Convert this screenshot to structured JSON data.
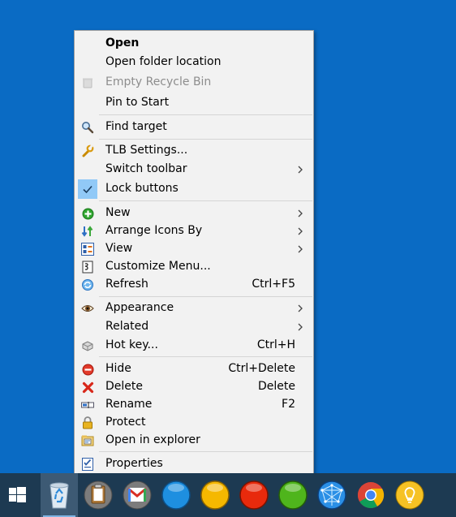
{
  "menu": {
    "items": [
      {
        "label": "Open",
        "bold": true
      },
      {
        "label": "Open folder location"
      },
      {
        "label": "Empty Recycle Bin",
        "icon": "recycle-bin-icon",
        "disabled": true
      },
      {
        "label": "Pin to Start"
      },
      {
        "label": "Find target",
        "icon": "magnifier-icon"
      },
      {
        "label": "TLB Settings...",
        "icon": "wrench-icon"
      },
      {
        "label": "Switch toolbar",
        "submenu": true
      },
      {
        "label": "Lock buttons",
        "checked": true,
        "icon": "checkmark-icon"
      },
      {
        "label": "New",
        "icon": "green-plus-icon",
        "submenu": true
      },
      {
        "label": "Arrange Icons By",
        "icon": "arrange-arrows-icon",
        "submenu": true
      },
      {
        "label": "View",
        "icon": "view-grid-icon",
        "submenu": true
      },
      {
        "label": "Customize Menu...",
        "icon": "customize-menu-icon"
      },
      {
        "label": "Refresh",
        "icon": "refresh-icon",
        "shortcut": "Ctrl+F5"
      },
      {
        "label": "Appearance",
        "icon": "eye-icon",
        "submenu": true
      },
      {
        "label": "Related",
        "submenu": true
      },
      {
        "label": "Hot key...",
        "icon": "keyboard-key-icon",
        "shortcut": "Ctrl+H"
      },
      {
        "label": "Hide",
        "icon": "red-minus-icon",
        "shortcut": "Ctrl+Delete"
      },
      {
        "label": "Delete",
        "icon": "red-x-icon",
        "shortcut": "Delete"
      },
      {
        "label": "Rename",
        "icon": "rename-icon",
        "shortcut": "F2"
      },
      {
        "label": "Protect",
        "icon": "padlock-icon"
      },
      {
        "label": "Open in explorer",
        "icon": "explorer-folder-icon"
      },
      {
        "label": "Properties",
        "icon": "properties-checklist-icon"
      }
    ]
  },
  "taskbar": {
    "buttons": [
      {
        "name": "start-button",
        "icon": "windows-logo-icon"
      },
      {
        "name": "recycle-bin-button",
        "icon": "recycle-bin-icon",
        "active": true
      },
      {
        "name": "clipboard-button",
        "icon": "clipboard-icon"
      },
      {
        "name": "gmail-button",
        "icon": "gmail-icon"
      },
      {
        "name": "blue-orb-button",
        "icon": "blue-orb-icon",
        "color": "#1e8fe0"
      },
      {
        "name": "yellow-orb-button",
        "icon": "yellow-orb-icon",
        "color": "#f5b800"
      },
      {
        "name": "red-orb-button",
        "icon": "red-orb-icon",
        "color": "#e82a0c"
      },
      {
        "name": "green-orb-button",
        "icon": "green-orb-icon",
        "color": "#4fb51c"
      },
      {
        "name": "network-globe-button",
        "icon": "network-globe-icon"
      },
      {
        "name": "chrome-button",
        "icon": "chrome-icon"
      },
      {
        "name": "lightbulb-button",
        "icon": "lightbulb-icon"
      }
    ]
  },
  "colors": {
    "desktop": "#0a6bc4",
    "taskbar": "#1d3a52",
    "menu_bg": "#f2f2f2",
    "check_highlight": "#91c9f7"
  }
}
